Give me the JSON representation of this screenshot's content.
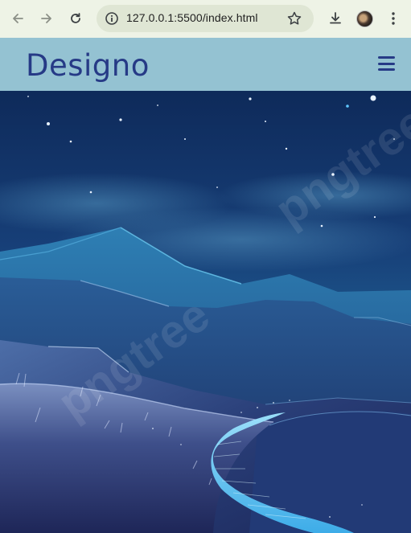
{
  "browser": {
    "url": "127.0.0.1:5500/index.html",
    "icons": [
      "back-arrow-icon",
      "forward-arrow-icon",
      "reload-icon",
      "site-info-icon",
      "bookmark-star-icon",
      "download-icon",
      "profile-avatar",
      "more-vert-icon"
    ]
  },
  "site": {
    "logo": "Designo",
    "menu_icon": "hamburger-menu-icon"
  },
  "hero": {
    "watermark": "pngtree",
    "image": "night-mountains-glowing-path-illustration"
  },
  "colors": {
    "chrome_bg": "#eef3e6",
    "address_bg": "#dfe6d4",
    "header_bg": "#94c2d2",
    "brand": "#263a86"
  }
}
